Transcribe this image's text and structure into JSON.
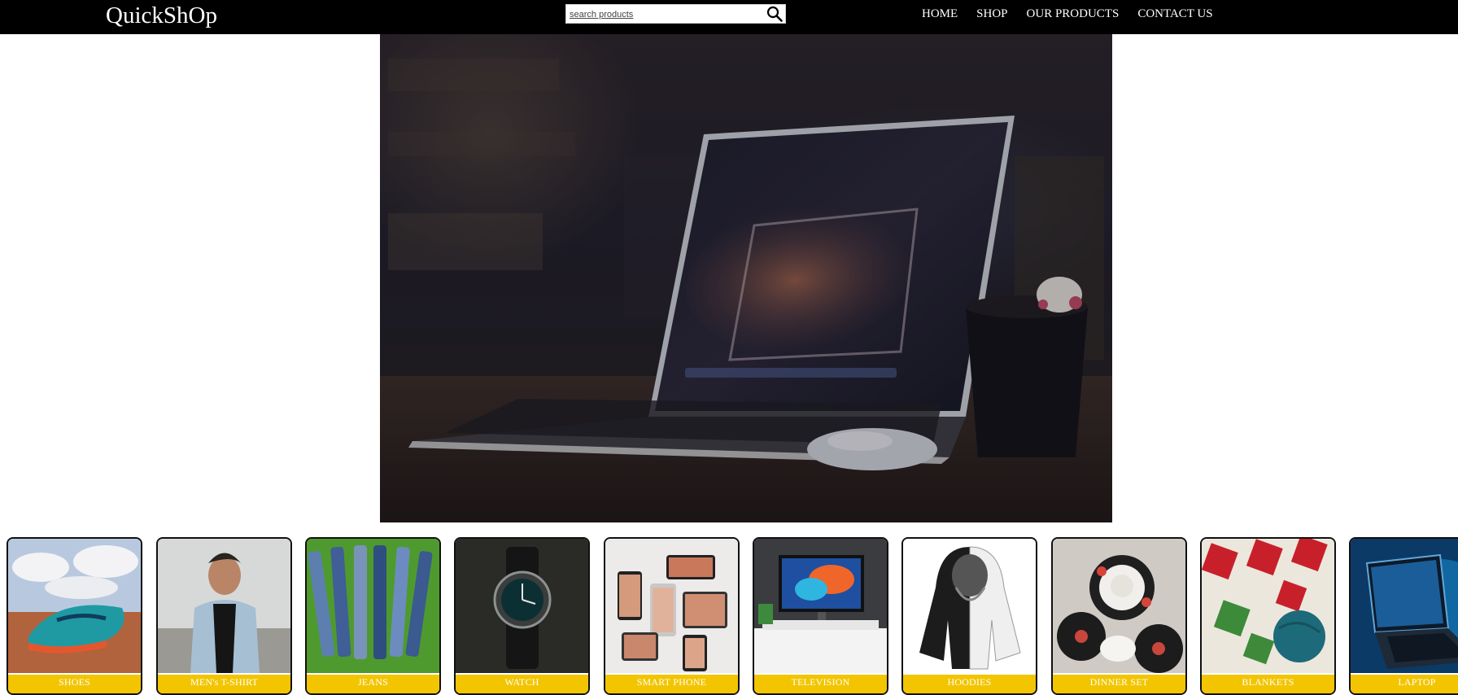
{
  "header": {
    "logo": "QuickShOp",
    "search": {
      "placeholder": "search products",
      "value": ""
    },
    "nav": [
      "HOME",
      "SHOP",
      "OUR PRODUCTS",
      "CONTACT US"
    ]
  },
  "categories": [
    {
      "label": "SHOES"
    },
    {
      "label": "MEN's T-SHIRT"
    },
    {
      "label": "JEANS"
    },
    {
      "label": "WATCH"
    },
    {
      "label": "SMART PHONE"
    },
    {
      "label": "TELEVISION"
    },
    {
      "label": "HOODIES"
    },
    {
      "label": "DINNER SET"
    },
    {
      "label": "BLANKETS"
    },
    {
      "label": "LAPTOP"
    }
  ],
  "colors": {
    "header_bg": "#000000",
    "label_bg": "#f2c500",
    "label_text": "#ffffff"
  }
}
